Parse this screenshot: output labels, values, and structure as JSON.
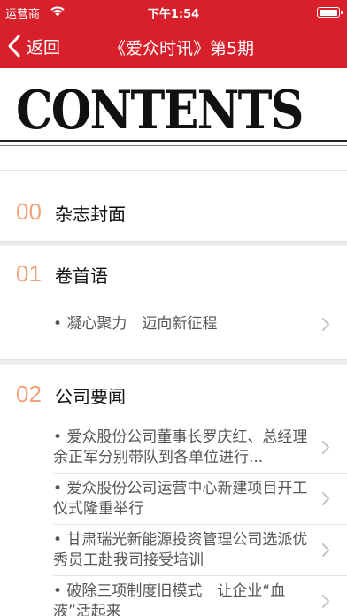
{
  "status_bar": {
    "carrier": "运营商",
    "time": "下午1:54"
  },
  "nav": {
    "back_label": "返回",
    "title": "《爱众时讯》第5期"
  },
  "banner": {
    "word": "CONTENTS"
  },
  "sections": [
    {
      "num": "00",
      "title": "杂志封面"
    },
    {
      "num": "01",
      "title": "卷首语",
      "items": [
        "• 凝心聚力　迈向新征程"
      ]
    },
    {
      "num": "02",
      "title": "公司要闻",
      "items": [
        "• 爱众股份公司董事长罗庆红、总经理余正军分别带队到各单位进行...",
        "• 爱众股份公司运营中心新建项目开工仪式隆重举行",
        "• 甘肃瑞光新能源投资管理公司选派优秀员工赴我司接受培训",
        "• 破除三项制度旧模式　让企业“血液”活起来"
      ]
    }
  ],
  "colors": {
    "nav_red": "#d7202b",
    "section_number": "#f0a279"
  }
}
